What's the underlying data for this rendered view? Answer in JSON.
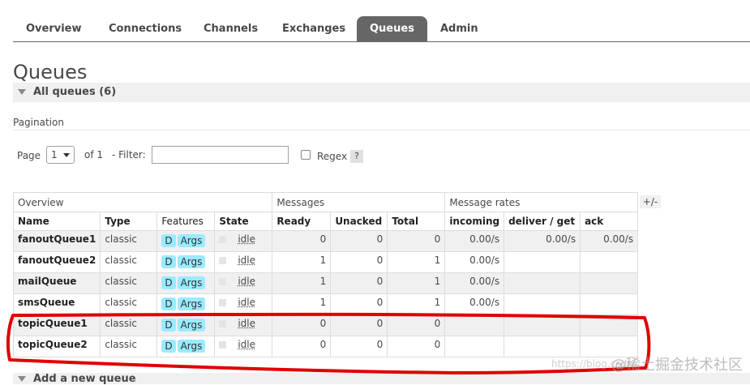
{
  "nav": {
    "tabs": [
      {
        "label": "Overview"
      },
      {
        "label": "Connections"
      },
      {
        "label": "Channels"
      },
      {
        "label": "Exchanges"
      },
      {
        "label": "Queues",
        "active": true
      },
      {
        "label": "Admin"
      }
    ]
  },
  "page": {
    "title": "Queues",
    "all_queues_label": "All queues (6)",
    "pagination_title": "Pagination",
    "add_queue_label": "Add a new queue"
  },
  "pagination": {
    "page_label": "Page",
    "page_value": "1",
    "of_label": "of 1",
    "filter_label": "- Filter:",
    "filter_value": "",
    "regex_label": "Regex",
    "help_label": "?"
  },
  "table": {
    "groups": {
      "overview": "Overview",
      "messages": "Messages",
      "rates": "Message rates"
    },
    "columns": [
      "Name",
      "Type",
      "Features",
      "State",
      "Ready",
      "Unacked",
      "Total",
      "incoming",
      "deliver / get",
      "ack"
    ],
    "toggle_label": "+/-",
    "feature_badges": {
      "durable": "D",
      "args": "Args"
    },
    "rows": [
      {
        "name": "fanoutQueue1",
        "type": "classic",
        "state": "idle",
        "ready": "0",
        "unacked": "0",
        "total": "0",
        "incoming": "0.00/s",
        "deliver": "0.00/s",
        "ack": "0.00/s"
      },
      {
        "name": "fanoutQueue2",
        "type": "classic",
        "state": "idle",
        "ready": "1",
        "unacked": "0",
        "total": "1",
        "incoming": "0.00/s",
        "deliver": "",
        "ack": ""
      },
      {
        "name": "mailQueue",
        "type": "classic",
        "state": "idle",
        "ready": "1",
        "unacked": "0",
        "total": "1",
        "incoming": "0.00/s",
        "deliver": "",
        "ack": ""
      },
      {
        "name": "smsQueue",
        "type": "classic",
        "state": "idle",
        "ready": "1",
        "unacked": "0",
        "total": "1",
        "incoming": "0.00/s",
        "deliver": "",
        "ack": ""
      },
      {
        "name": "topicQueue1",
        "type": "classic",
        "state": "idle",
        "ready": "0",
        "unacked": "0",
        "total": "0",
        "incoming": "",
        "deliver": "",
        "ack": ""
      },
      {
        "name": "topicQueue2",
        "type": "classic",
        "state": "idle",
        "ready": "0",
        "unacked": "0",
        "total": "0",
        "incoming": "",
        "deliver": "",
        "ack": ""
      }
    ]
  },
  "watermark": {
    "text": "@稀土掘金技术社区",
    "url_text": "https://blog.csdn"
  },
  "colors": {
    "active_tab": "#666666",
    "badge": "#99ebff",
    "annotation": "#e00000",
    "band": "#f0f0f0"
  }
}
